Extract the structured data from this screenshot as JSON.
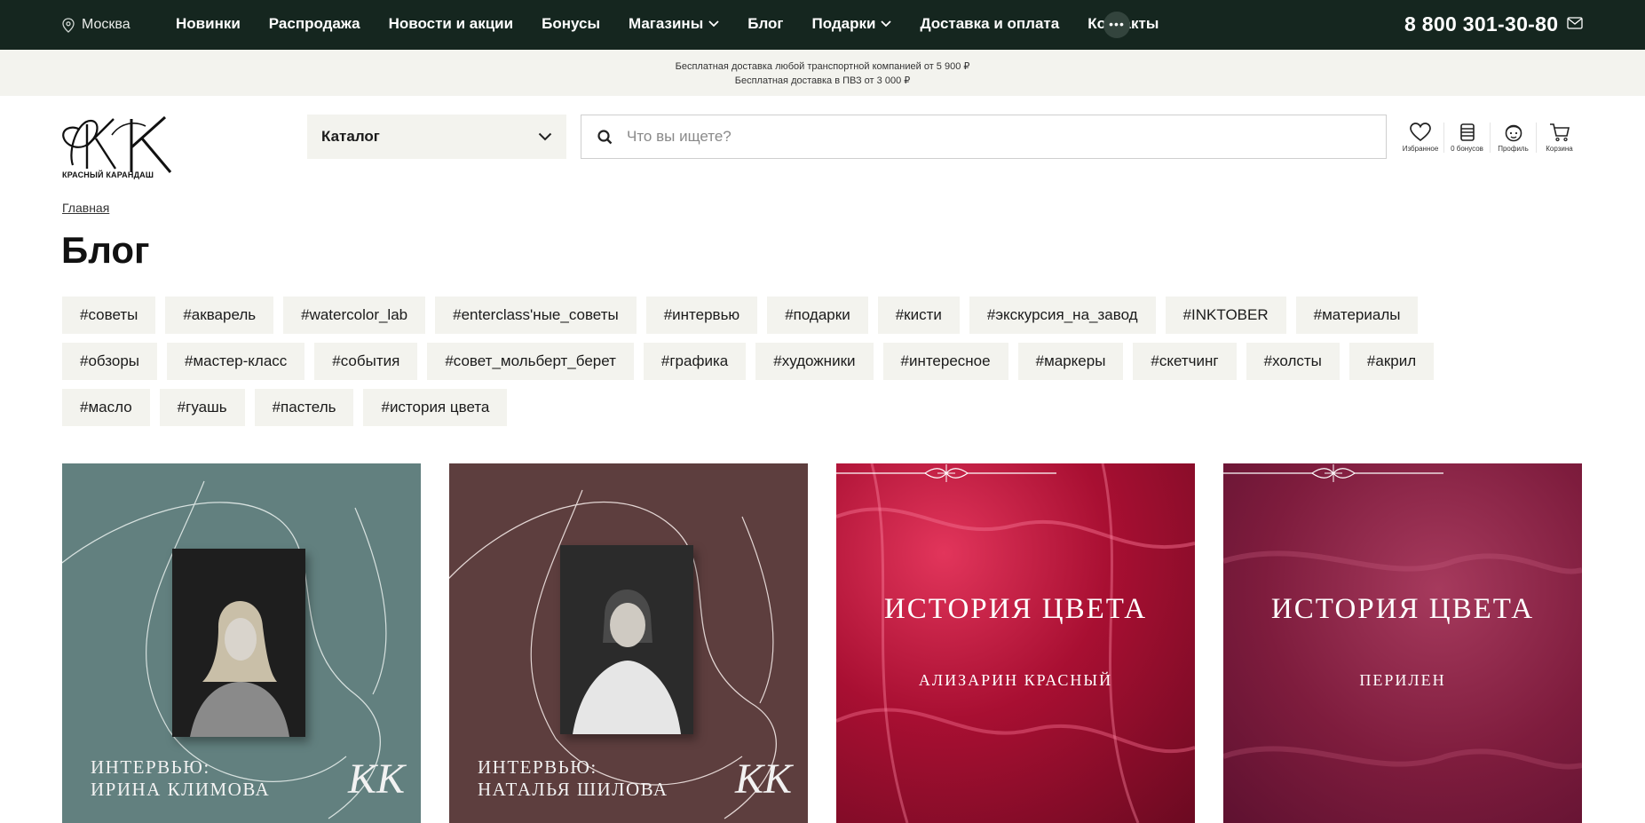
{
  "topbar": {
    "city": "Москва",
    "nav": [
      "Новинки",
      "Распродажа",
      "Новости и акции",
      "Бонусы",
      "Магазины",
      "Блог",
      "Подарки",
      "Доставка и оплата",
      "Контакты"
    ],
    "more": "•••",
    "phone": "8 800 301-30-80"
  },
  "promo": {
    "line1": "Бесплатная доставка любой транспортной компанией от 5 900 ₽",
    "line2": "Бесплатная доставка в ПВЗ от 3 000 ₽"
  },
  "header": {
    "logo_text": "КРАСНЫЙ КАРАНДАШ",
    "catalog_label": "Каталог",
    "search_placeholder": "Что вы ищете?",
    "icons": [
      {
        "label": "Избранное",
        "icon": "heart-icon"
      },
      {
        "label": "0 бонусов",
        "icon": "bonus-icon"
      },
      {
        "label": "Профиль",
        "icon": "profile-icon"
      },
      {
        "label": "Корзина",
        "icon": "cart-icon"
      }
    ]
  },
  "breadcrumb": "Главная",
  "page_title": "Блог",
  "tags": [
    [
      "#советы",
      "#акварель",
      "#watercolor_lab",
      "#enterclass'ные_советы",
      "#интервью",
      "#подарки",
      "#кисти",
      "#экскурсия_на_завод",
      "#INKTOBER",
      "#материалы"
    ],
    [
      "#обзоры",
      "#мастер-класс",
      "#события",
      "#совет_мольберт_берет",
      "#графика",
      "#художники",
      "#интересное",
      "#маркеры",
      "#скетчинг",
      "#холсты",
      "#акрил"
    ],
    [
      "#масло",
      "#гуашь",
      "#пастель",
      "#история цвета"
    ]
  ],
  "cards": [
    {
      "caption1": "ИНТЕРВЬЮ:",
      "caption2": "ИРИНА КЛИМОВА",
      "mono": "KK",
      "bg": "#62807f"
    },
    {
      "caption1": "ИНТЕРВЬЮ:",
      "caption2": "НАТАЛЬЯ ШИЛОВА",
      "mono": "KK",
      "bg": "#5d3e3e"
    },
    {
      "title": "ИСТОРИЯ ЦВЕТА",
      "subtitle": "АЛИЗАРИН КРАСНЫЙ",
      "bg": "#a80f32"
    },
    {
      "title": "ИСТОРИЯ ЦВЕТА",
      "subtitle": "ПЕРИЛЕН",
      "bg": "#7e1c3d"
    }
  ],
  "colors": {
    "topbar": "#15261f",
    "promo": "#f3f3ee",
    "tag_bg": "#f3f3ee"
  }
}
